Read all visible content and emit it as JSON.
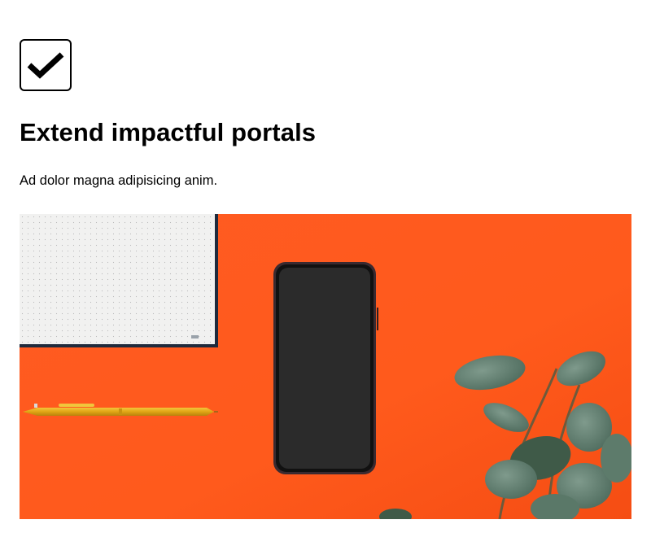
{
  "feature": {
    "icon": "checkbox-checked-icon",
    "title": "Extend impactful portals",
    "description": "Ad dolor magna adipisicing anim."
  },
  "hero_image": {
    "subject": "desk-flatlay-photo"
  }
}
